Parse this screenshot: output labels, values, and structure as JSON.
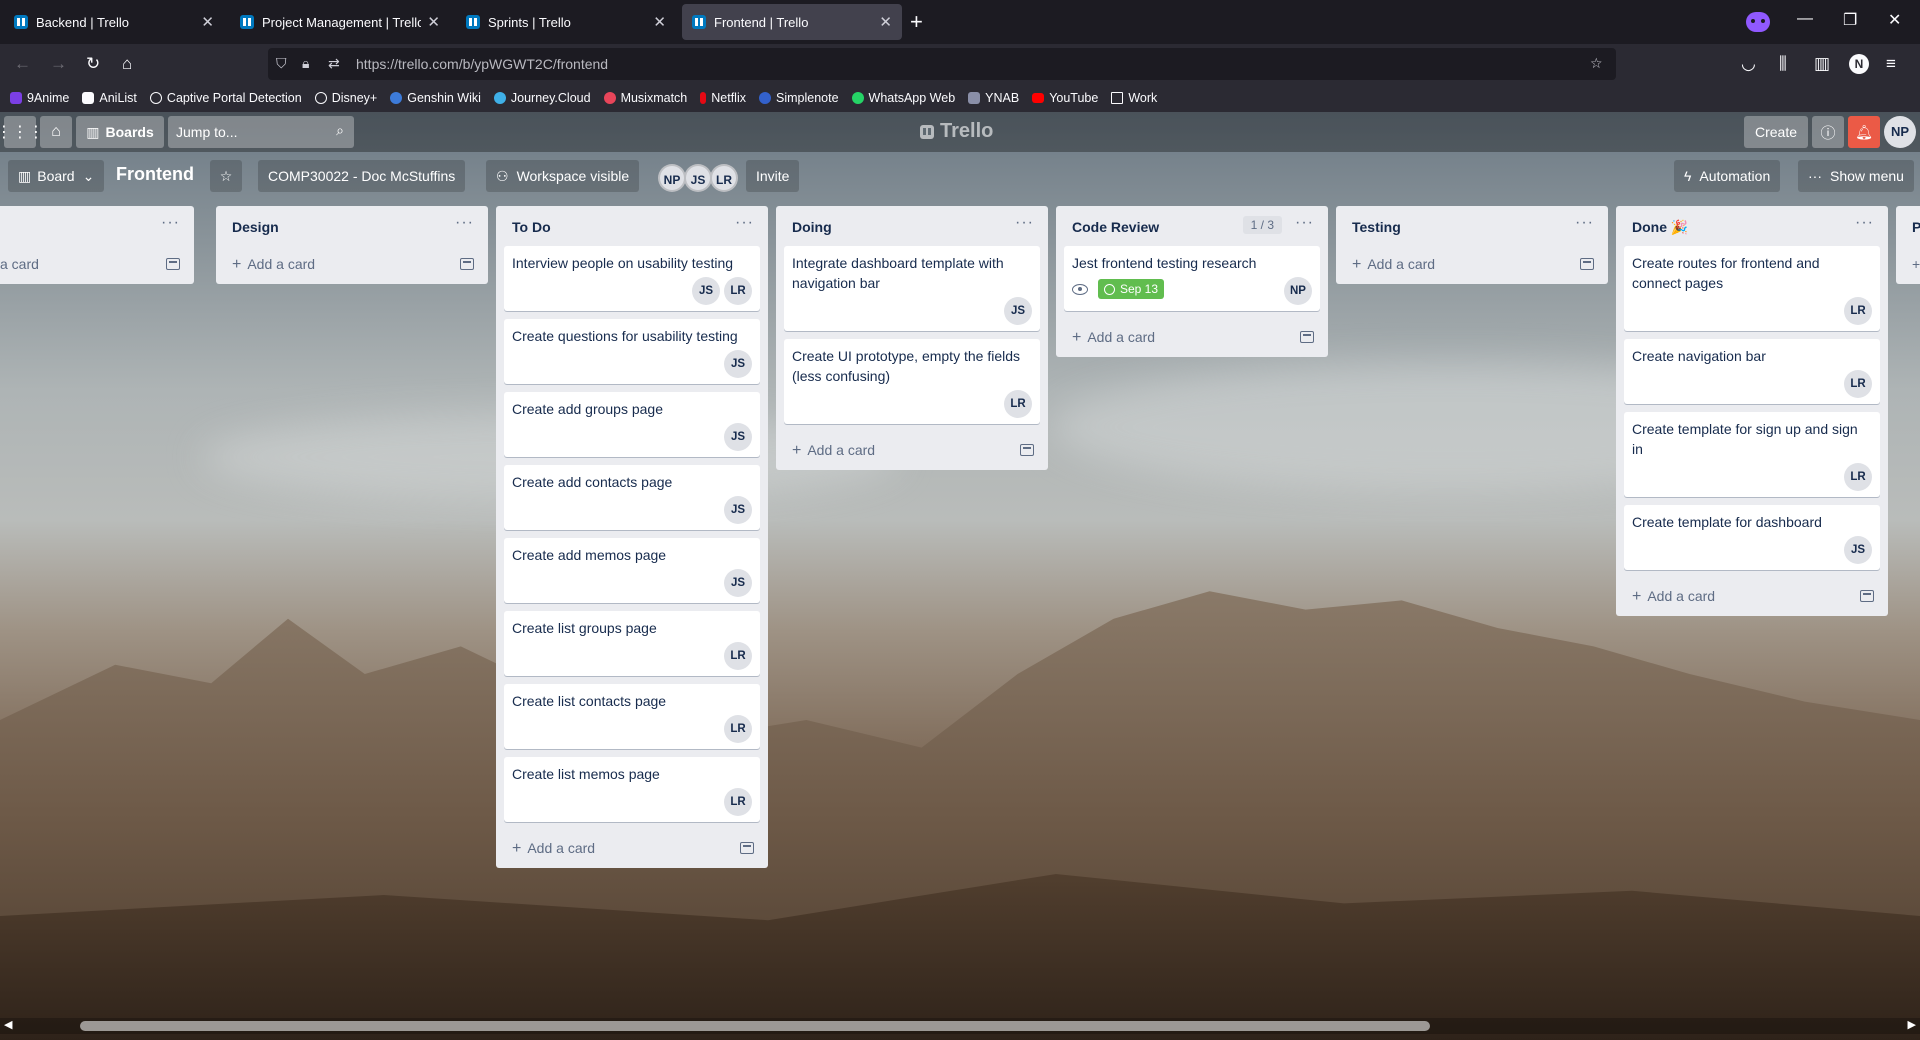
{
  "browser": {
    "tabs": [
      {
        "title": "Backend | Trello",
        "active": false
      },
      {
        "title": "Project Management | Trello",
        "active": false
      },
      {
        "title": "Sprints | Trello",
        "active": false
      },
      {
        "title": "Frontend | Trello",
        "active": true
      }
    ],
    "url": "https://trello.com/b/ypWGWT2C/frontend",
    "profile_initial": "N",
    "bookmarks": [
      {
        "label": "9Anime",
        "color": "#7b3fe4"
      },
      {
        "label": "AniList",
        "color": "#2b2a33"
      },
      {
        "label": "Captive Portal Detection",
        "color": "#2b2a33"
      },
      {
        "label": "Disney+",
        "color": "#2b2a33"
      },
      {
        "label": "Genshin Wiki",
        "color": "#3d7bd9"
      },
      {
        "label": "Journey.Cloud",
        "color": "#3fb0e8"
      },
      {
        "label": "Musixmatch",
        "color": "#e8455a"
      },
      {
        "label": "Netflix",
        "color": "#e50914"
      },
      {
        "label": "Simplenote",
        "color": "#3361cc"
      },
      {
        "label": "WhatsApp Web",
        "color": "#25d366"
      },
      {
        "label": "YNAB",
        "color": "#8a8fa8"
      },
      {
        "label": "YouTube",
        "color": "#ff0000"
      },
      {
        "label": "Work",
        "color": "#2b2a33"
      }
    ]
  },
  "trello": {
    "header": {
      "boards_label": "Boards",
      "jump_placeholder": "Jump to...",
      "logo": "Trello",
      "create_label": "Create",
      "user_initials": "NP"
    },
    "board": {
      "view_label": "Board",
      "title": "Frontend",
      "workspace": "COMP30022 - Doc McStuffins",
      "visibility": "Workspace visible",
      "members": [
        "NP",
        "JS",
        "LR"
      ],
      "invite_label": "Invite",
      "automation_label": "Automation",
      "show_menu_label": "Show menu"
    },
    "add_card_label": "Add a card",
    "partial_list": {
      "add_card_fragment": "a card"
    },
    "lists": [
      {
        "title": "Design",
        "count": "",
        "cards": []
      },
      {
        "title": "To Do",
        "count": "",
        "cards": [
          {
            "title": "Interview people on usability testing",
            "members": [
              "JS",
              "LR"
            ]
          },
          {
            "title": "Create questions for usability testing",
            "members": [
              "JS"
            ]
          },
          {
            "title": "Create add groups page",
            "members": [
              "JS"
            ]
          },
          {
            "title": "Create add contacts page",
            "members": [
              "JS"
            ]
          },
          {
            "title": "Create add memos page",
            "members": [
              "JS"
            ]
          },
          {
            "title": "Create list groups page",
            "members": [
              "LR"
            ]
          },
          {
            "title": "Create list contacts page",
            "members": [
              "LR"
            ]
          },
          {
            "title": "Create list memos page",
            "members": [
              "LR"
            ]
          }
        ]
      },
      {
        "title": "Doing",
        "count": "",
        "cards": [
          {
            "title": "Integrate dashboard template with navigation bar",
            "members": [
              "JS"
            ]
          },
          {
            "title": "Create UI prototype, empty the fields (less confusing)",
            "members": [
              "LR"
            ]
          }
        ]
      },
      {
        "title": "Code Review",
        "count": "1 / 3",
        "cards": [
          {
            "title": "Jest frontend testing research",
            "members": [
              "NP"
            ],
            "watching": true,
            "due": "Sep 13"
          }
        ]
      },
      {
        "title": "Testing",
        "count": "",
        "cards": []
      },
      {
        "title": "Done 🎉",
        "count": "",
        "cards": [
          {
            "title": "Create routes for frontend and connect pages",
            "members": [
              "LR"
            ]
          },
          {
            "title": "Create navigation bar",
            "members": [
              "LR"
            ]
          },
          {
            "title": "Create template for sign up and sign in",
            "members": [
              "LR"
            ]
          },
          {
            "title": "Create template for dashboard",
            "members": [
              "JS"
            ]
          }
        ]
      }
    ],
    "next_list_fragment": "P"
  }
}
